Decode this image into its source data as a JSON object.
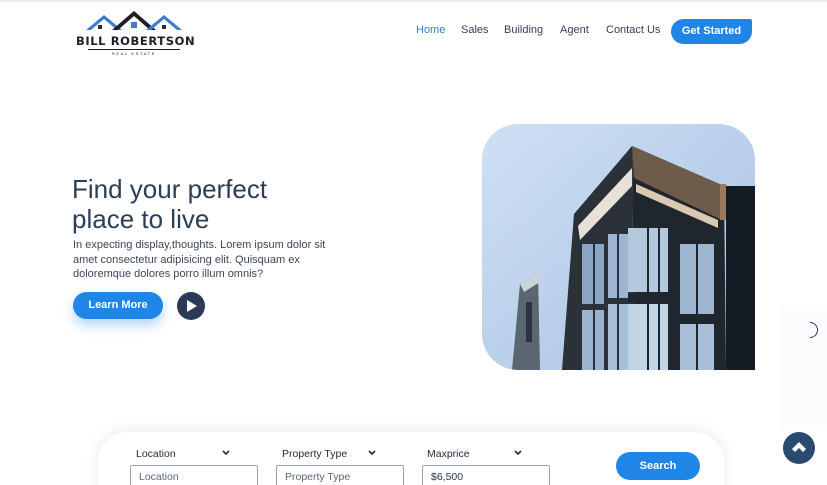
{
  "brand": {
    "name": "BILL ROBERTSON",
    "tagline": "REAL ESTATE"
  },
  "nav": {
    "items": [
      "Home",
      "Sales",
      "Building",
      "Agent",
      "Contact Us"
    ],
    "active": "Home"
  },
  "header": {
    "cta_label": "Get Started"
  },
  "hero": {
    "title_line1": "Find your perfect",
    "title_line2": "place to live",
    "desc_line1": "In expecting display,thoughts. Lorem ipsum dolor sit",
    "desc_line2": "amet consectetur adipisicing elit. Quisquam ex",
    "desc_line3": "doloremque dolores porro illum omnis?",
    "learn_more_label": "Learn More",
    "play_icon": "play-icon",
    "image_icon": "building-photo"
  },
  "search": {
    "fields": [
      {
        "label": "Location",
        "placeholder": "Location",
        "value": ""
      },
      {
        "label": "Property Type",
        "placeholder": "Property Type",
        "value": ""
      },
      {
        "label": "Maxprice",
        "placeholder": "",
        "value": "$6,500"
      }
    ],
    "button_label": "Search"
  },
  "scroll_top_icon": "chevron-up-icon",
  "colors": {
    "accent": "#1f86e8",
    "dark": "#2b3a55",
    "active_nav": "#2f7fd6"
  }
}
